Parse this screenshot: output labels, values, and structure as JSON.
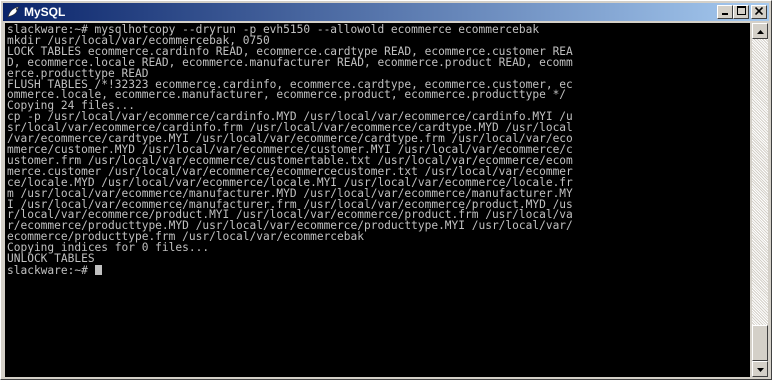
{
  "window": {
    "title": "MySQL",
    "icon": "mysql-icon"
  },
  "title_buttons": {
    "minimize": "_",
    "maximize": "□",
    "close": "✕"
  },
  "console": {
    "lines": [
      "slackware:~# mysqlhotcopy --dryrun -p evh5150 --allowold ecommerce ecommercebak",
      "mkdir /usr/local/var/ecommercebak, 0750",
      "LOCK TABLES ecommerce.cardinfo READ, ecommerce.cardtype READ, ecommerce.customer REA",
      "D, ecommerce.locale READ, ecommerce.manufacturer READ, ecommerce.product READ, ecomm",
      "erce.producttype READ",
      "FLUSH TABLES /*!32323 ecommerce.cardinfo, ecommerce.cardtype, ecommerce.customer, ec",
      "ommerce.locale, ecommerce.manufacturer, ecommerce.product, ecommerce.producttype */",
      "Copying 24 files...",
      "cp -p /usr/local/var/ecommerce/cardinfo.MYD /usr/local/var/ecommerce/cardinfo.MYI /u",
      "sr/local/var/ecommerce/cardinfo.frm /usr/local/var/ecommerce/cardtype.MYD /usr/local",
      "/var/ecommerce/cardtype.MYI /usr/local/var/ecommerce/cardtype.frm /usr/local/var/eco",
      "mmerce/customer.MYD /usr/local/var/ecommerce/customer.MYI /usr/local/var/ecommerce/c",
      "ustomer.frm /usr/local/var/ecommerce/customertable.txt /usr/local/var/ecommerce/ecom",
      "merce.customer /usr/local/var/ecommerce/ecommercecustomer.txt /usr/local/var/ecommer",
      "ce/locale.MYD /usr/local/var/ecommerce/locale.MYI /usr/local/var/ecommerce/locale.fr",
      "m /usr/local/var/ecommerce/manufacturer.MYD /usr/local/var/ecommerce/manufacturer.MY",
      "I /usr/local/var/ecommerce/manufacturer.frm /usr/local/var/ecommerce/product.MYD /us",
      "r/local/var/ecommerce/product.MYI /usr/local/var/ecommerce/product.frm /usr/local/va",
      "r/ecommerce/producttype.MYD /usr/local/var/ecommerce/producttype.MYI /usr/local/var/",
      "ecommerce/producttype.frm /usr/local/var/ecommercebak",
      "Copying indices for 0 files...",
      "UNLOCK TABLES"
    ],
    "prompt": "slackware:~# "
  },
  "colors": {
    "titlebar_start": "#0a246a",
    "titlebar_end": "#a6caf0",
    "console_bg": "#000000",
    "console_fg": "#c0c0c0"
  }
}
